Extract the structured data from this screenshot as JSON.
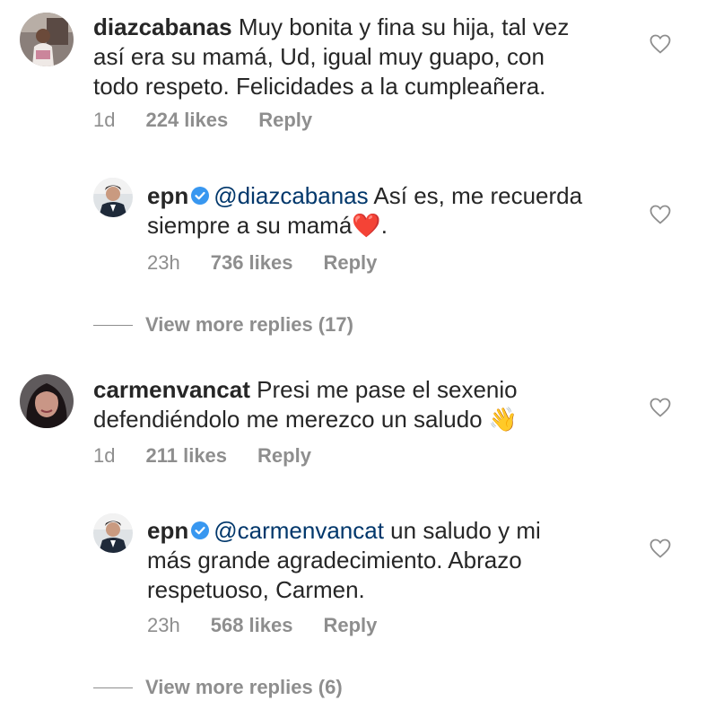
{
  "comments": [
    {
      "username": "diazcabanas",
      "text": "Muy bonita y fina su hija, tal vez así era su mamá, Ud, igual muy guapo, con todo respeto. Felicidades a la cumpleañera.",
      "lines": [
        "Muy bonita y fina su hija, tal vez",
        "así era su mamá, Ud, igual muy guapo, con",
        "todo respeto. Felicidades a la cumpleañera."
      ],
      "time": "1d",
      "likes": "224 likes",
      "reply": "Reply"
    },
    {
      "username": "carmenvancat",
      "lines": [
        "Presi me pase el sexenio",
        "defendiéndolo me merezco un saludo"
      ],
      "emoji": "👋",
      "time": "1d",
      "likes": "211 likes",
      "reply": "Reply"
    }
  ],
  "replies": [
    {
      "username": "epn",
      "mention": "@diazcabanas",
      "lines": [
        "Así es, me recuerda",
        "siempre a su mamá"
      ],
      "emoji": "❤️",
      "trailing": ".",
      "time": "23h",
      "likes": "736 likes",
      "reply": "Reply",
      "view_more": "View more replies (17)"
    },
    {
      "username": "epn",
      "mention": "@carmenvancat",
      "lines": [
        "un saludo y mi",
        "más grande agradecimiento. Abrazo",
        "respetuoso, Carmen."
      ],
      "time": "23h",
      "likes": "568 likes",
      "reply": "Reply",
      "view_more": "View more replies (6)"
    }
  ],
  "colors": {
    "text": "#262626",
    "secondary": "#8e8e8e",
    "mention": "#00376b",
    "verified": "#3897f0",
    "heart_emoji": "#e0245e"
  }
}
